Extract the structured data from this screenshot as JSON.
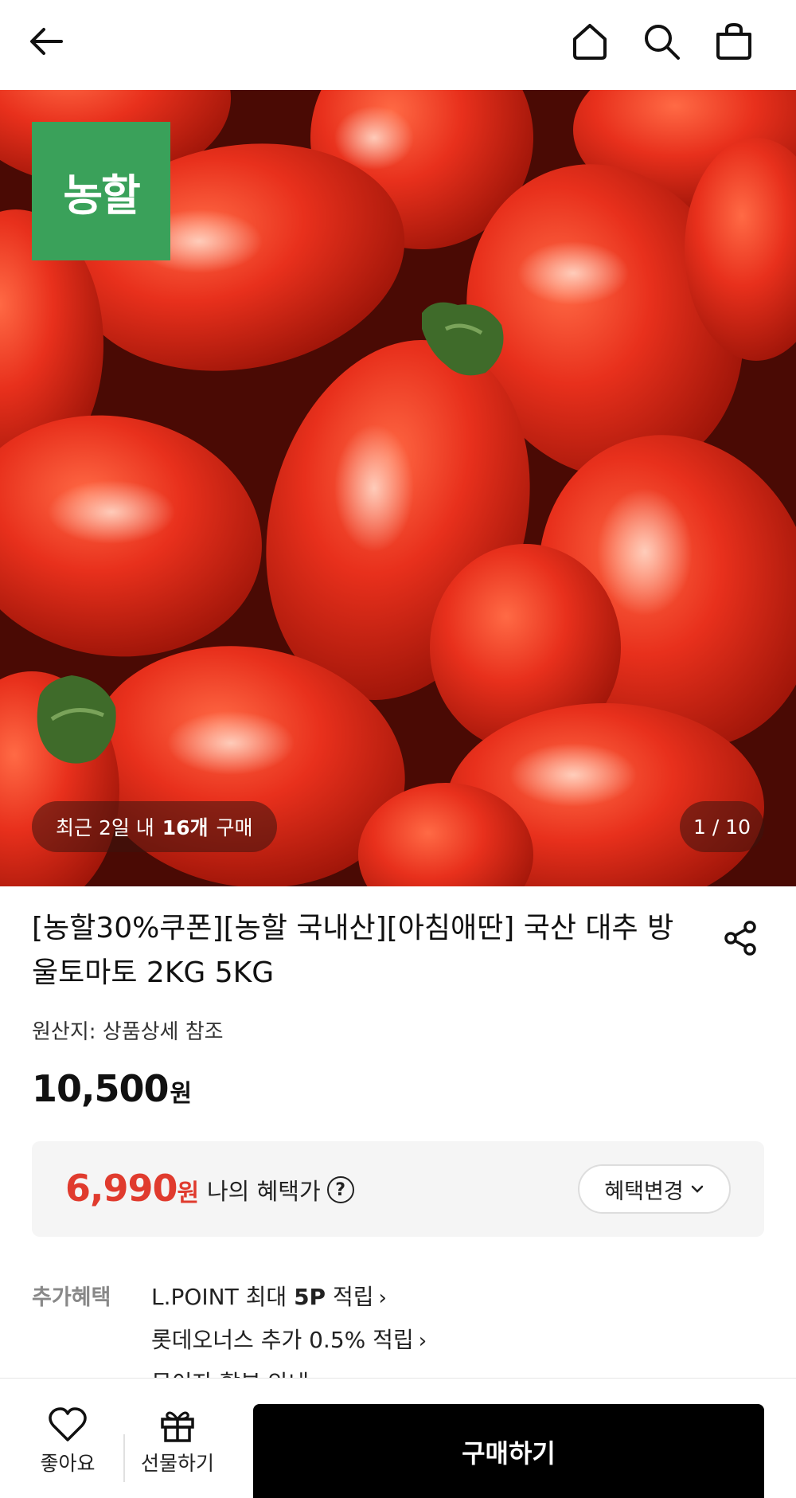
{
  "header": {
    "back_icon": "arrow-left-icon",
    "home_icon": "home-icon",
    "search_icon": "search-icon",
    "cart_icon": "shopping-bag-icon"
  },
  "hero": {
    "brand_logo_text": "농할",
    "recent_prefix": "최근 2일 내",
    "recent_count": "16개",
    "recent_suffix": "구매",
    "image_counter": "1 / 10"
  },
  "product": {
    "title": "[농할30%쿠폰][농할 국내산][아침애딴] 국산 대추 방울토마토 2KG 5KG",
    "origin": "원산지: 상품상세 참조",
    "price": "10,500",
    "price_unit": "원"
  },
  "benefit": {
    "price": "6,990",
    "price_unit": "원",
    "label": "나의 혜택가",
    "change_label": "혜택변경"
  },
  "extra_benefits": {
    "label": "추가혜택",
    "items": [
      {
        "prefix": "L.POINT 최대 ",
        "bold": "5P",
        "suffix": " 적립"
      },
      {
        "prefix": "롯데오너스 추가 0.5% 적립",
        "bold": "",
        "suffix": ""
      },
      {
        "prefix": "무이자 할부 안내",
        "bold": "",
        "suffix": ""
      }
    ]
  },
  "bottom_bar": {
    "like_label": "좋아요",
    "gift_label": "선물하기",
    "buy_label": "구매하기"
  },
  "colors": {
    "brand_green": "#3aa15a",
    "benefit_red": "#e03b2e",
    "tomato_red": "#e8301c"
  }
}
